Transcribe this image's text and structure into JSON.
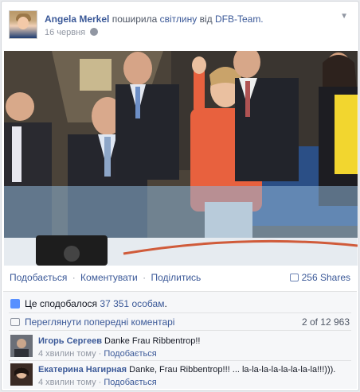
{
  "post": {
    "author": "Angela Merkel",
    "shared_text": "поширила",
    "object_link": "світлину",
    "from_text": "від",
    "source_page": "DFB-Team.",
    "date": "16 червня"
  },
  "actions": {
    "like": "Подобається",
    "comment": "Коментувати",
    "share": "Поділитись",
    "shares": "256 Shares",
    "separator": "·"
  },
  "likes": {
    "prefix": "Це сподобалося",
    "count": "37 351 особам",
    "suffix": "."
  },
  "previous": {
    "label": "Переглянути попередні коментарі",
    "count": "2 of 12 963"
  },
  "comments": [
    {
      "author": "Игорь Сергеев",
      "text": "Danke Frau Ribbentrop!!",
      "time": "4 хвилин тому",
      "like": "Подобається"
    },
    {
      "author": "Екатерина Нагирная",
      "text": "Danke, Frau Ribbentrop!!! ... la-la-la-la-la-la-la-la!!!))).",
      "time": "4 хвилин тому",
      "like": "Подобається"
    }
  ],
  "icons": [
    "avatar",
    "globe-icon",
    "chevron-down-icon",
    "share-icon",
    "like-thumb-icon",
    "comments-icon"
  ],
  "colors": {
    "link": "#3b5998",
    "meta": "#9197a3",
    "ufi_bg": "#f6f7f9",
    "jacket": "#e8613e"
  }
}
